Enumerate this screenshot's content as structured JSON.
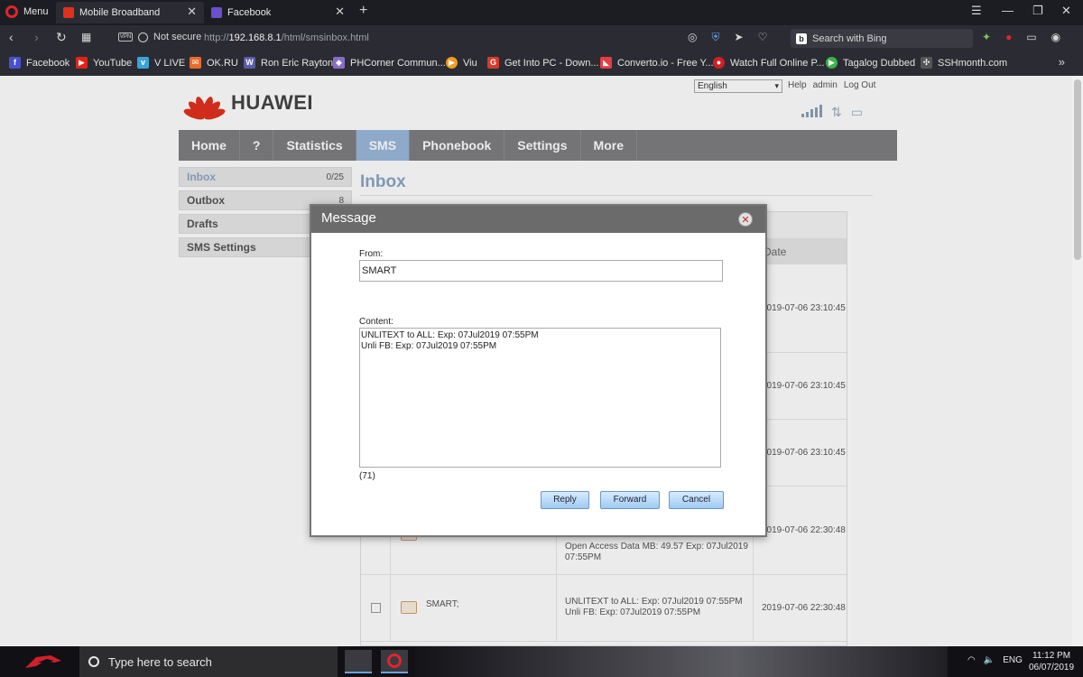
{
  "browser": {
    "menu_label": "Menu",
    "tabs": [
      {
        "title": "Mobile Broadband"
      },
      {
        "title": "Facebook"
      }
    ],
    "security": "Not secure",
    "url_prefix": "http://",
    "url_host": "192.168.8.1",
    "url_path": "/html/smsinbox.html",
    "search_placeholder": "Search with Bing",
    "bookmarks": [
      {
        "label": "Facebook",
        "icon": "facebook-icon",
        "color": "#4a4fcf"
      },
      {
        "label": "YouTube",
        "icon": "youtube-icon",
        "color": "#e62117"
      },
      {
        "label": "V LIVE",
        "icon": "vlive-icon",
        "color": "#3aa3d8"
      },
      {
        "label": "OK.RU",
        "icon": "okru-icon",
        "color": "#e96b2a"
      },
      {
        "label": "Ron Eric Rayton",
        "icon": "ron-icon",
        "color": "#5b5ba8"
      },
      {
        "label": "PHCorner Commun...",
        "icon": "phcorner-icon",
        "color": "#8a6cc8"
      },
      {
        "label": "Viu",
        "icon": "viu-icon",
        "color": "#f29b1d"
      },
      {
        "label": "Get Into PC - Down...",
        "icon": "getintopc-icon",
        "color": "#d63a2c"
      },
      {
        "label": "Converto.io - Free Y...",
        "icon": "converto-icon",
        "color": "#e73d45"
      },
      {
        "label": "Watch Full Online P...",
        "icon": "watch-icon",
        "color": "#c22"
      },
      {
        "label": "Tagalog Dubbed",
        "icon": "tagalog-icon",
        "color": "#3cb449"
      },
      {
        "label": "SSHmonth.com",
        "icon": "ssh-icon",
        "color": "#888"
      }
    ]
  },
  "page": {
    "brand": "HUAWEI",
    "language": "English",
    "top_links": [
      "Help",
      "admin",
      "Log Out"
    ],
    "nav": [
      "Home",
      "?",
      "Statistics",
      "SMS",
      "Phonebook",
      "Settings",
      "More"
    ],
    "nav_active_index": 3,
    "side_menu": [
      {
        "label": "Inbox",
        "count": "0/25"
      },
      {
        "label": "Outbox",
        "count": "8"
      },
      {
        "label": "Drafts",
        "count": ""
      },
      {
        "label": "SMS Settings",
        "count": ""
      }
    ],
    "inbox_title": "Inbox",
    "table_header_date": "Date",
    "rows": [
      {
        "date": "2019-07-06 23:10:45",
        "content": "",
        "sender": ""
      },
      {
        "date": "2019-07-06 23:10:45",
        "content": "",
        "sender": ""
      },
      {
        "date": "2019-07-06 23:10:45",
        "content": "",
        "sender": ""
      },
      {
        "date": "2019-07-06 22:30:48",
        "content_line1": "Open Access Data MB:  49.57 Exp: 07Jul2019",
        "content_line2": "07:55PM",
        "sender": ""
      },
      {
        "date": "2019-07-06 22:30:48",
        "content_line1": "UNLITEXT to ALL: Exp: 07Jul2019 07:55PM",
        "content_line2": "Unli FB: Exp: 07Jul2019 07:55PM",
        "sender": "SMART;"
      }
    ]
  },
  "dialog": {
    "title": "Message",
    "from_label": "From:",
    "from_value": "SMART",
    "content_label": "Content:",
    "content_value": "UNLITEXT to ALL: Exp: 07Jul2019 07:55PM\nUnli FB: Exp: 07Jul2019 07:55PM",
    "char_count": "(71)",
    "buttons": {
      "reply": "Reply",
      "forward": "Forward",
      "cancel": "Cancel"
    }
  },
  "taskbar": {
    "search_placeholder": "Type here to search",
    "language": "ENG",
    "time": "11:12 PM",
    "date": "06/07/2019"
  }
}
